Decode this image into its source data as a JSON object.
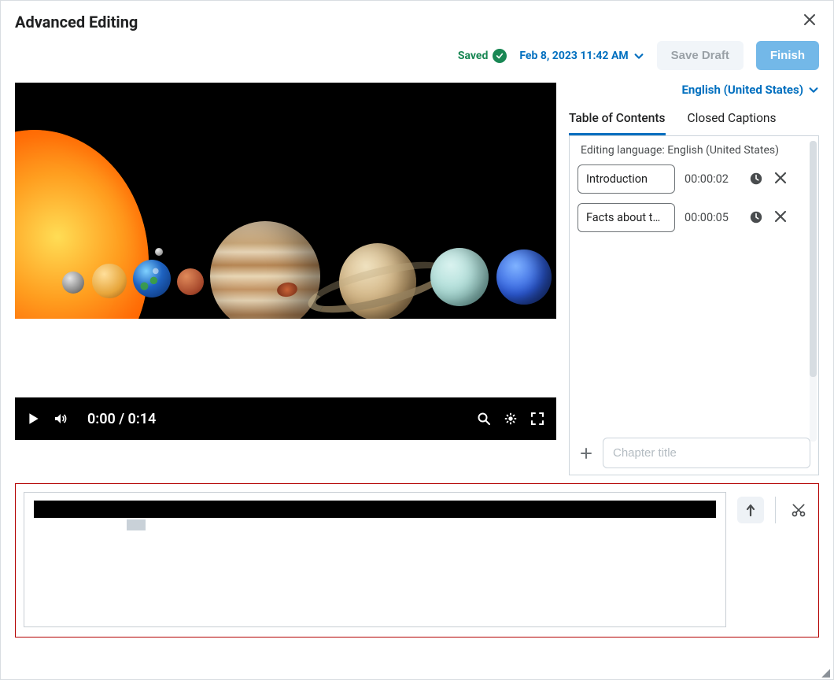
{
  "header": {
    "title": "Advanced Editing"
  },
  "actions": {
    "saved_label": "Saved",
    "timestamp": "Feb 8, 2023 11:42 AM",
    "save_draft_label": "Save Draft",
    "finish_label": "Finish"
  },
  "video": {
    "current_time": "0:00",
    "total_time": "0:14",
    "time_display": "0:00 / 0:14"
  },
  "language_selector": {
    "label": "English (United States)"
  },
  "tabs": {
    "toc": "Table of Contents",
    "cc": "Closed Captions"
  },
  "panel": {
    "editing_language_label": "Editing language: English (United States)",
    "entries": [
      {
        "title": "Introduction",
        "time": "00:00:02"
      },
      {
        "title": "Facts about t…",
        "time": "00:00:05"
      }
    ],
    "chapter_placeholder": "Chapter title"
  },
  "icons": {
    "close": "close-icon",
    "check": "check-circle-icon",
    "chevron_down": "chevron-down-icon",
    "play": "play-icon",
    "volume": "volume-icon",
    "search": "search-icon",
    "settings": "gear-icon",
    "fullscreen": "fullscreen-icon",
    "clock": "clock-icon",
    "delete": "close-icon",
    "add": "plus-icon",
    "mark": "timeline-mark-icon",
    "cut": "scissors-icon"
  }
}
